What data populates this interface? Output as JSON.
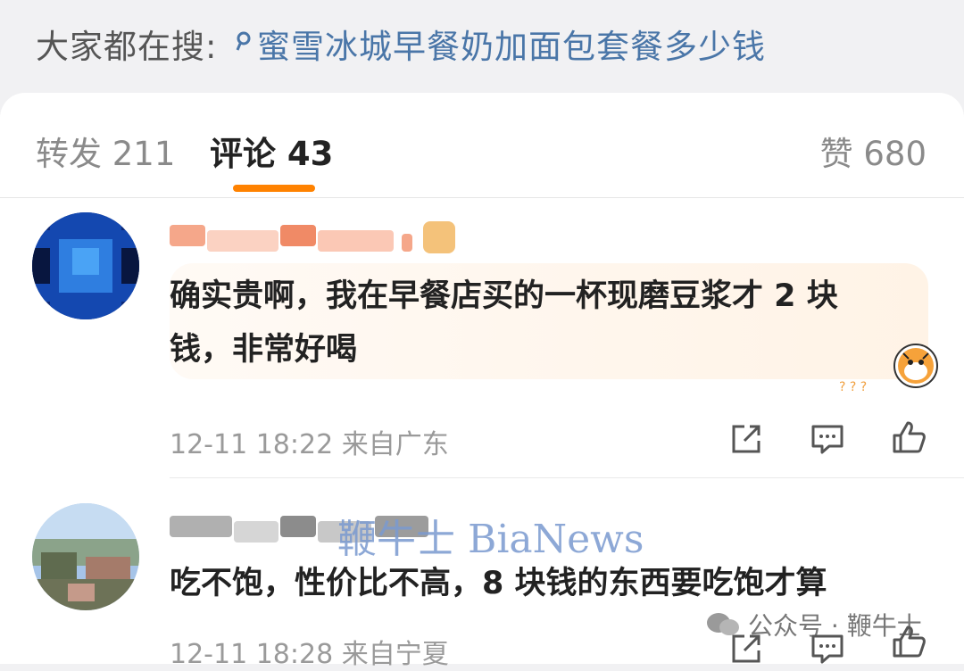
{
  "search": {
    "prefix": "大家都在搜:",
    "query": "蜜雪冰城早餐奶加面包套餐多少钱"
  },
  "tabs": {
    "repost": "转发 211",
    "comments": "评论 43",
    "likes": "赞 680"
  },
  "comments": [
    {
      "text_line1": "确实贵啊，我在早餐店买的一杯现磨豆浆才 2 块",
      "text_line2": "钱，非常好喝",
      "meta": "12-11 18:22  来自广东"
    },
    {
      "text": "吃不饱，性价比不高，8 块钱的东西要吃饱才算",
      "meta": "12-11 18:28  来自宁夏"
    }
  ],
  "watermark": "鞭牛士 BiaNews",
  "wechat_credit": "公众号 · 鞭牛士",
  "colors": {
    "accent": "#ff8200",
    "link": "#4a76a8"
  }
}
